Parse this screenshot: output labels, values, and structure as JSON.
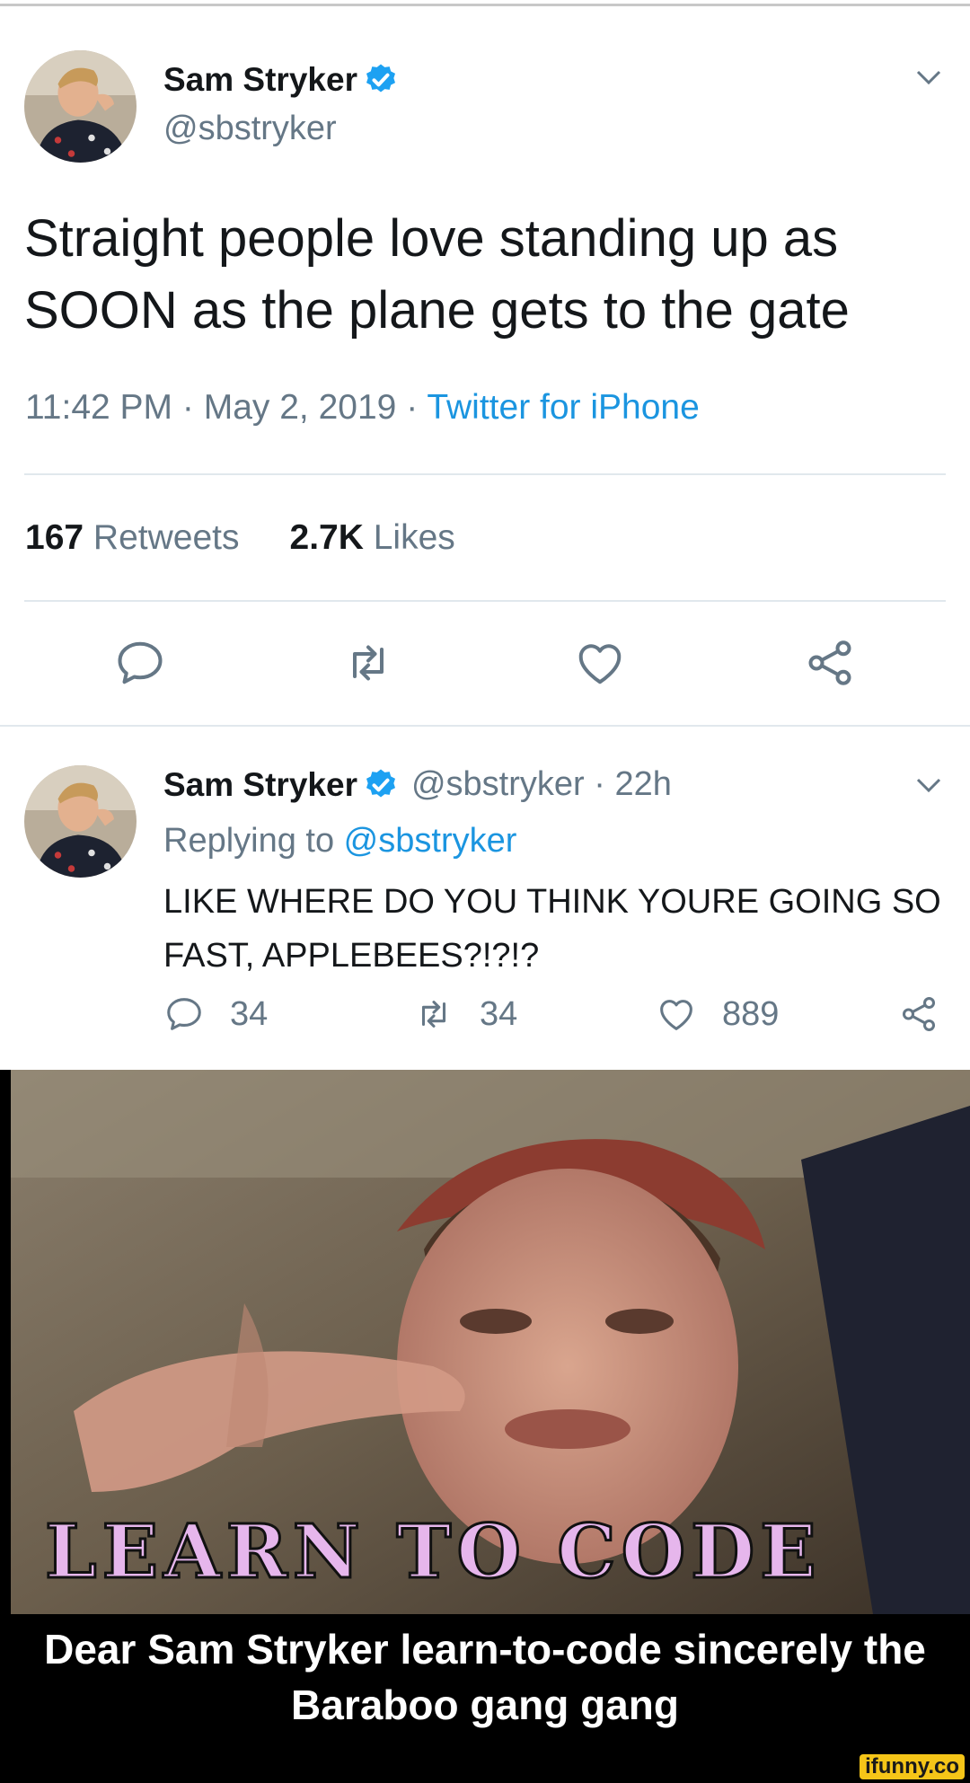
{
  "tweet": {
    "author_name": "Sam Stryker",
    "handle": "@sbstryker",
    "text": "Straight people love standing up as SOON as the plane gets to the gate",
    "time": "11:42 PM",
    "date": "May 2, 2019",
    "source": "Twitter for iPhone",
    "separator": " · ",
    "retweets_count": "167",
    "retweets_label": "Retweets",
    "likes_count": "2.7K",
    "likes_label": "Likes"
  },
  "reply": {
    "author_name": "Sam Stryker",
    "handle": "@sbstryker",
    "age": "22h",
    "separator": " · ",
    "replying_prefix": "Replying to ",
    "replying_handle": "@sbstryker",
    "text": "LIKE WHERE DO YOU THINK YOURE GOING SO FAST, APPLEBEES?!?!?",
    "reply_count": "34",
    "retweet_count": "34",
    "like_count": "889"
  },
  "meme": {
    "overlay_text": "LEARN TO CODE",
    "caption": "Dear Sam Stryker learn-to-code sincerely the Baraboo gang gang",
    "watermark": "ifunny.co"
  },
  "colors": {
    "link_blue": "#1b95e0",
    "verified_blue": "#1da1f2",
    "secondary_grey": "#657786",
    "overlay_pink": "#e6b6ec"
  },
  "icons": [
    "verified-badge-icon",
    "chevron-down-icon",
    "reply-icon",
    "retweet-icon",
    "like-icon",
    "share-icon"
  ]
}
